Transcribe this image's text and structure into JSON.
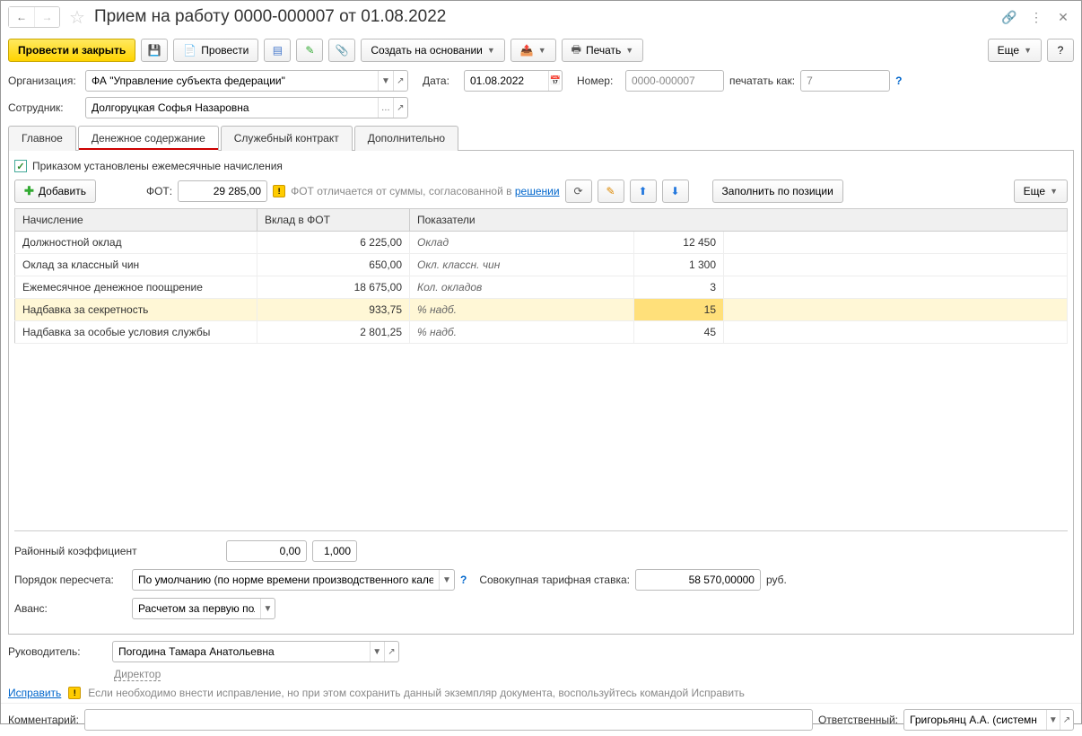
{
  "title": "Прием на работу 0000-000007 от 01.08.2022",
  "toolbar": {
    "post_close": "Провести и закрыть",
    "post": "Провести",
    "create_based": "Создать на основании",
    "print": "Печать",
    "more": "Еще",
    "help": "?"
  },
  "form": {
    "org_label": "Организация:",
    "org_value": "ФА \"Управление субъекта федерации\"",
    "date_label": "Дата:",
    "date_value": "01.08.2022",
    "number_label": "Номер:",
    "number_value": "0000-000007",
    "print_as_label": "печатать как:",
    "print_as_value": "7",
    "employee_label": "Сотрудник:",
    "employee_value": "Долгоруцкая Софья Назаровна"
  },
  "tabs": {
    "main": "Главное",
    "salary": "Денежное содержание",
    "contract": "Служебный контракт",
    "extra": "Дополнительно"
  },
  "salary": {
    "checkbox_label": "Приказом установлены ежемесячные начисления",
    "add": "Добавить",
    "fot_label": "ФОТ:",
    "fot_value": "29 285,00",
    "warn_text": "ФОТ отличается от суммы, согласованной в ",
    "warn_link": "решении",
    "fill_by_pos": "Заполнить по позиции",
    "more": "Еще",
    "col_accrual": "Начисление",
    "col_contrib": "Вклад в ФОТ",
    "col_indicators": "Показатели",
    "rows": [
      {
        "name": "Должностной оклад",
        "contrib": "6 225,00",
        "indicator_label": "Оклад",
        "indicator_value": "12 450"
      },
      {
        "name": "Оклад за классный чин",
        "contrib": "650,00",
        "indicator_label": "Окл. классн. чин",
        "indicator_value": "1 300"
      },
      {
        "name": "Ежемесячное денежное поощрение",
        "contrib": "18 675,00",
        "indicator_label": "Кол. окладов",
        "indicator_value": "3"
      },
      {
        "name": "Надбавка за секретность",
        "contrib": "933,75",
        "indicator_label": "% надб.",
        "indicator_value": "15"
      },
      {
        "name": "Надбавка за особые условия службы",
        "contrib": "2 801,25",
        "indicator_label": "% надб.",
        "indicator_value": "45"
      }
    ],
    "district_coef_label": "Районный коэффициент",
    "district_coef_v1": "0,00",
    "district_coef_v2": "1,000",
    "recalc_label": "Порядок пересчета:",
    "recalc_value": "По умолчанию (по норме времени производственного кален",
    "rate_label": "Совокупная тарифная ставка:",
    "rate_value": "58 570,00000",
    "rate_unit": "руб.",
    "advance_label": "Аванс:",
    "advance_value": "Расчетом за первую пол"
  },
  "manager": {
    "label": "Руководитель:",
    "value": "Погодина Тамара Анатольевна",
    "position": "Директор"
  },
  "correct": {
    "link": "Исправить",
    "text": "Если необходимо внести исправление, но при этом сохранить данный экземпляр документа, воспользуйтесь командой Исправить"
  },
  "footer": {
    "comment_label": "Комментарий:",
    "responsible_label": "Ответственный:",
    "responsible_value": "Григорьянц А.А. (системн"
  }
}
